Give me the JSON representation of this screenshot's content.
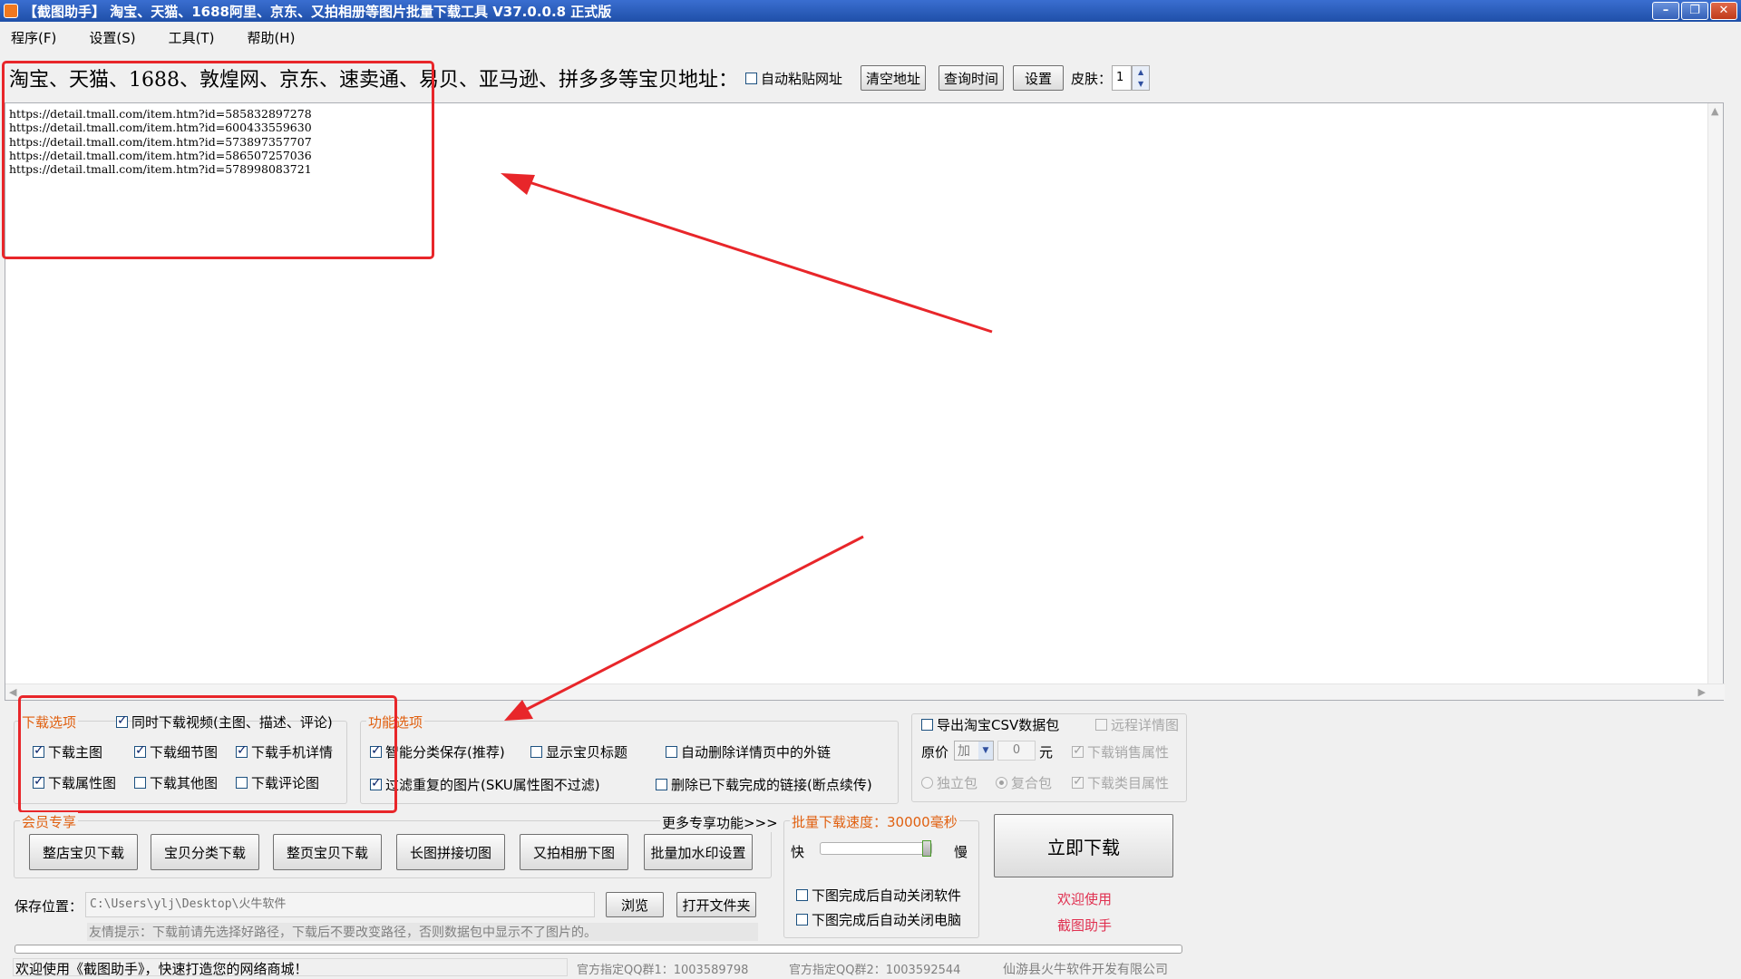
{
  "window": {
    "title": "【截图助手】 淘宝、天猫、1688阿里、京东、又拍相册等图片批量下载工具 V37.0.0.8 正式版"
  },
  "menu": [
    {
      "label": "程序(F)"
    },
    {
      "label": "设置(S)"
    },
    {
      "label": "工具(T)"
    },
    {
      "label": "帮助(H)"
    }
  ],
  "address_row": {
    "label": "淘宝、天猫、1688、敦煌网、京东、速卖通、易贝、亚马逊、拼多多等宝贝地址：",
    "auto_paste_label": "自动粘贴网址",
    "clear_label": "清空地址",
    "query_time_label": "查询时间",
    "settings_label": "设置",
    "skin_label": "皮肤：",
    "skin_value": "1"
  },
  "urls": "https://detail.tmall.com/item.htm?id=585832897278\nhttps://detail.tmall.com/item.htm?id=600433559630\nhttps://detail.tmall.com/item.htm?id=573897357707\nhttps://detail.tmall.com/item.htm?id=586507257036\nhttps://detail.tmall.com/item.htm?id=578998083721",
  "download_options": {
    "title": "下载选项",
    "sync_video": "同时下载视频(主图、描述、评论)",
    "main_img": "下载主图",
    "detail_img": "下载细节图",
    "mobile_detail": "下载手机详情",
    "attr_img": "下载属性图",
    "other_img": "下载其他图",
    "comment_img": "下载评论图"
  },
  "feature_options": {
    "title": "功能选项",
    "smart_save": "智能分类保存(推荐)",
    "show_title": "显示宝贝标题",
    "auto_delete_links": "自动删除详情页中的外链",
    "filter_dupes": "过滤重复的图片(SKU属性图不过滤)",
    "delete_done": "删除已下载完成的链接(断点续传)"
  },
  "csv_options": {
    "export_csv": "导出淘宝CSV数据包",
    "remote_detail": "远程详情图",
    "original_price": "原价",
    "price_op": "加",
    "price_value": "0",
    "currency": "元",
    "download_sales_attr": "下载销售属性",
    "standalone": "独立包",
    "composite": "复合包",
    "download_category_attr": "下载类目属性"
  },
  "vip": {
    "title": "会员专享",
    "more": "更多专享功能>>>",
    "buttons": [
      "整店宝贝下载",
      "宝贝分类下载",
      "整页宝贝下载",
      "长图拼接切图",
      "又拍相册下图",
      "批量加水印设置"
    ]
  },
  "speed": {
    "label": "批量下载速度：30000毫秒",
    "fast": "快",
    "slow": "慢",
    "close_software": "下图完成后自动关闭软件",
    "close_pc": "下图完成后自动关闭电脑"
  },
  "download_now": "立即下载",
  "welcome1": "欢迎使用",
  "welcome2": "截图助手",
  "save": {
    "label": "保存位置：",
    "path": "C:\\Users\\ylj\\Desktop\\火牛软件",
    "browse": "浏览",
    "open_folder": "打开文件夹",
    "tip": "友情提示：下载前请先选择好路径，下载后不要改变路径，否则数据包中显示不了图片的。"
  },
  "status": {
    "welcome": "欢迎使用《截图助手》，快速打造您的网络商城！",
    "qq1": "官方指定QQ群1：1003589798",
    "qq2": "官方指定QQ群2：1003592544",
    "company": "仙游县火牛软件开发有限公司"
  }
}
